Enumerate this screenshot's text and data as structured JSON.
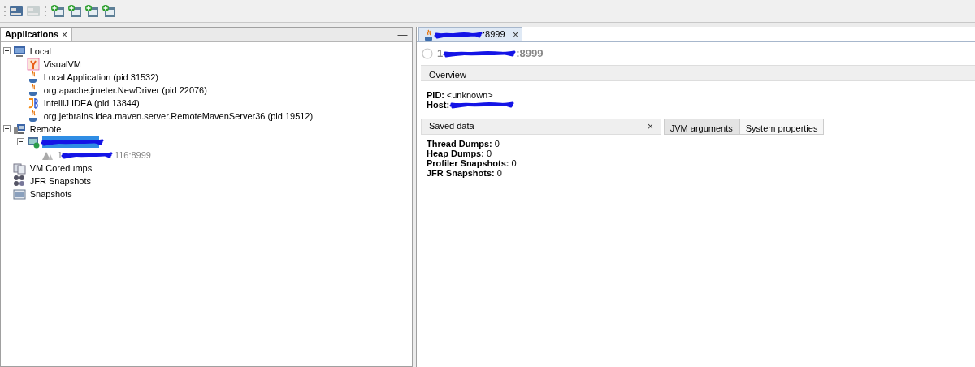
{
  "toolbar": [
    {
      "disabled": false
    },
    {
      "disabled": true
    },
    {
      "disabled": false
    },
    {
      "disabled": false
    },
    {
      "disabled": false
    },
    {
      "disabled": false
    }
  ],
  "applications_panel": {
    "title": "Applications",
    "close": "×",
    "minimize": "—",
    "tree": [
      {
        "label": "Local",
        "expanded": true,
        "children": [
          {
            "label": "VisualVM"
          },
          {
            "label": "Local Application (pid 31532)"
          },
          {
            "label": "org.apache.jmeter.NewDriver (pid 22076)"
          },
          {
            "label": "IntelliJ IDEA (pid 13844)"
          },
          {
            "label": "org.jetbrains.idea.maven.server.RemoteMavenServer36 (pid 19512)"
          }
        ]
      },
      {
        "label": "Remote",
        "expanded": true,
        "children": [
          {
            "redacted": true,
            "selected": true,
            "expanded": true,
            "children": [
              {
                "label": "1",
                "suffix": "116:8999",
                "redacted": true,
                "disabled": true
              }
            ]
          }
        ]
      },
      {
        "label": "VM Coredumps"
      },
      {
        "label": "JFR Snapshots"
      },
      {
        "label": "Snapshots"
      }
    ]
  },
  "document_tabs": [
    {
      "label": ":8999",
      "close": "×",
      "redacted": true,
      "selected": true
    }
  ],
  "overview": {
    "heading_prefix": "1",
    "heading_suffix": ":8999",
    "section_title": "Overview",
    "fields": [
      {
        "label": "PID:",
        "value": "<unknown>"
      },
      {
        "label": "Host:",
        "redacted": true
      }
    ]
  },
  "saved_data": {
    "title": "Saved data",
    "close": "×",
    "items": [
      {
        "label": "Thread Dumps:",
        "value": "0"
      },
      {
        "label": "Heap Dumps:",
        "value": "0"
      },
      {
        "label": "Profiler Snapshots:",
        "value": "0"
      },
      {
        "label": "JFR Snapshots:",
        "value": "0"
      }
    ]
  },
  "detail_tabs": [
    {
      "label": "JVM arguments",
      "selected": true
    },
    {
      "label": "System properties",
      "selected": false
    }
  ]
}
